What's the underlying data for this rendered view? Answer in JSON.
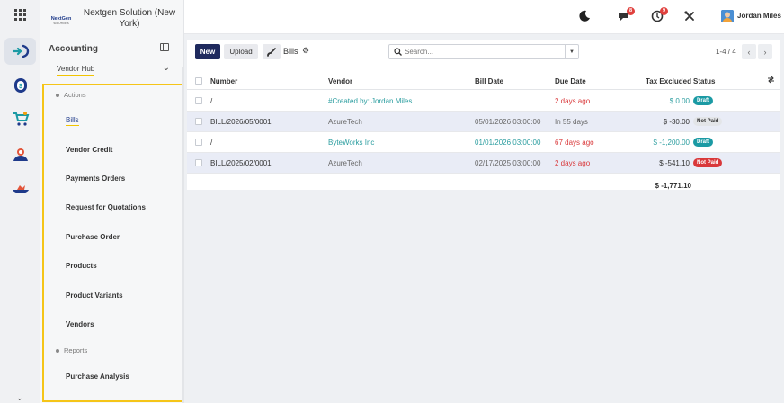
{
  "company": {
    "name": "Nextgen Solution (New York)",
    "logo_text": "NextGen"
  },
  "sidebar": {
    "app_title": "Accounting",
    "vendor_hub": "Vendor Hub",
    "sections": [
      {
        "label": "Actions",
        "items": [
          "Bills",
          "Vendor Credit",
          "Payments Orders",
          "Request for Quotations",
          "Purchase Order",
          "Products",
          "Product Variants",
          "Vendors"
        ]
      },
      {
        "label": "Reports",
        "items": [
          "Purchase Analysis"
        ]
      }
    ],
    "active_item": "Bills"
  },
  "topbar": {
    "user": "Jordan Miles",
    "chat_badge": "8",
    "activity_badge": "9"
  },
  "toolbar": {
    "new_label": "New",
    "upload_label": "Upload",
    "breadcrumb": "Bills",
    "search_placeholder": "Search...",
    "pager": "1-4 / 4"
  },
  "table": {
    "columns": [
      "Number",
      "Vendor",
      "Bill Date",
      "Due Date",
      "Tax Excluded",
      "Status"
    ],
    "rows": [
      {
        "number": "/",
        "vendor": "#Created by: Jordan Miles",
        "bill_date": "",
        "due_date": "2 days ago",
        "tax_excluded": "$ 0.00",
        "status": "Draft"
      },
      {
        "number": "BILL/2026/05/0001",
        "vendor": "AzureTech",
        "bill_date": "05/01/2026 03:00:00",
        "due_date": "In 55 days",
        "tax_excluded": "$ -30.00",
        "status": "Not Paid"
      },
      {
        "number": "/",
        "vendor": "ByteWorks Inc",
        "bill_date": "01/01/2026 03:00:00",
        "due_date": "67 days ago",
        "tax_excluded": "$ -1,200.00",
        "status": "Draft"
      },
      {
        "number": "BILL/2025/02/0001",
        "vendor": "AzureTech",
        "bill_date": "02/17/2025 03:00:00",
        "due_date": "2 days ago",
        "tax_excluded": "$ -541.10",
        "status": "Not Paid"
      }
    ],
    "total": "$ -1,771.10"
  },
  "colors": {
    "primary": "#1f2a5e",
    "teal": "#2a9d9f",
    "red": "#d9383a",
    "highlight": "#f5c518"
  }
}
